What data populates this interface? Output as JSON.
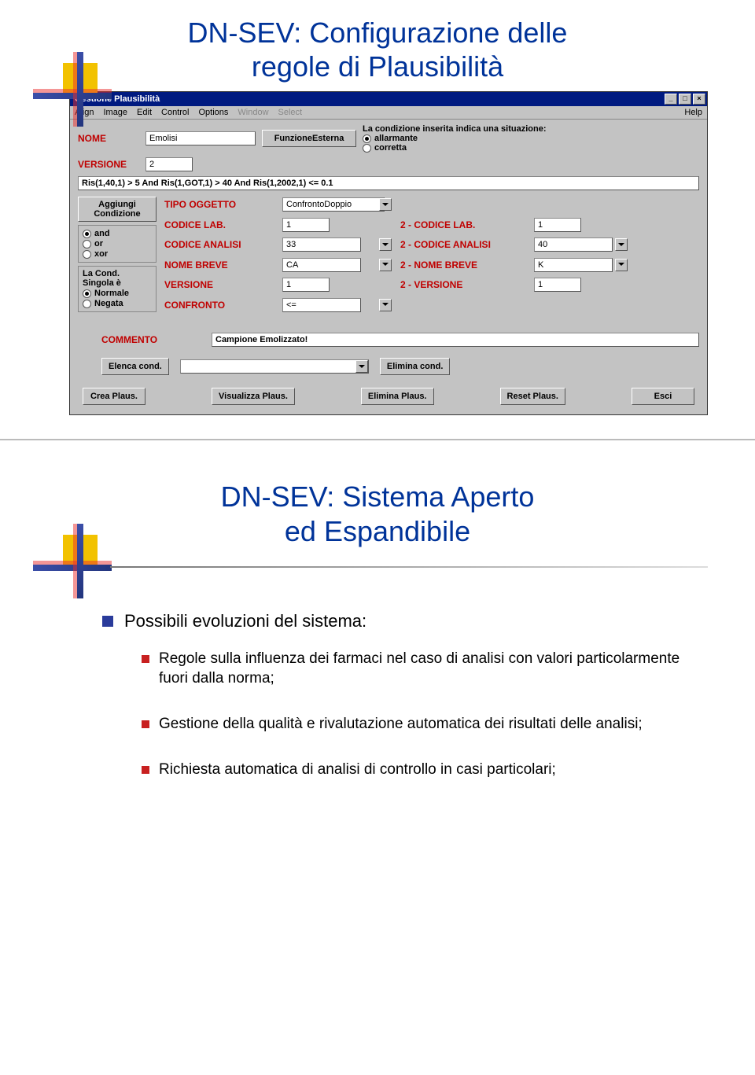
{
  "slide1": {
    "title_l1": "DN-SEV: Configurazione delle",
    "title_l2": "regole di Plausibilità"
  },
  "app": {
    "title": "Gestione Plausibilità",
    "menu": {
      "align": "Align",
      "image": "Image",
      "edit": "Edit",
      "control": "Control",
      "options": "Options",
      "window": "Window",
      "select": "Select",
      "help": "Help"
    },
    "header": {
      "nome_label": "NOME",
      "versione_label": "VERSIONE",
      "nome_value": "Emolisi",
      "versione_value": "2",
      "funz_btn": "FunzioneEsterna",
      "cond_text": "La condizione inserita indica una situazione:",
      "r_allarmante": "allarmante",
      "r_corretta": "corretta"
    },
    "cond_expr": "Ris(1,40,1) > 5 And Ris(1,GOT,1) > 40 And Ris(1,2002,1) <= 0.1",
    "left": {
      "aggiungi_l1": "Aggiungi",
      "aggiungi_l2": "Condizione",
      "and": "and",
      "or": "or",
      "xor": "xor",
      "lacond_l1": "La Cond.",
      "lacond_l2": "Singola è",
      "normale": "Normale",
      "negata": "Negata"
    },
    "fields": {
      "tipo_oggetto": "TIPO OGGETTO",
      "tipo_oggetto_v": "ConfrontoDoppio",
      "codice_lab": "CODICE LAB.",
      "codice_lab_v": "1",
      "codice_analisi": "CODICE ANALISI",
      "codice_analisi_v": "33",
      "nome_breve": "NOME BREVE",
      "nome_breve_v": "CA",
      "versione": "VERSIONE",
      "versione_v": "1",
      "confronto": "CONFRONTO",
      "confronto_v": "<="
    },
    "fields2": {
      "codice_lab": "2 - CODICE LAB.",
      "codice_lab_v": "1",
      "codice_analisi": "2 - CODICE ANALISI",
      "codice_analisi_v": "40",
      "nome_breve": "2 - NOME BREVE",
      "nome_breve_v": "K",
      "versione": "2 - VERSIONE",
      "versione_v": "1"
    },
    "commento_lbl": "COMMENTO",
    "commento_v": "Campione Emolizzato!",
    "btns": {
      "elenca": "Elenca cond.",
      "elimina_cond": "Elimina cond.",
      "crea": "Crea Plaus.",
      "visualizza": "Visualizza Plaus.",
      "elimina": "Elimina Plaus.",
      "reset": "Reset Plaus.",
      "esci": "Esci"
    }
  },
  "slide2": {
    "title_l1": "DN-SEV: Sistema Aperto",
    "title_l2": "ed Espandibile",
    "lead": "Possibili evoluzioni del sistema:",
    "items": [
      "Regole sulla influenza dei farmaci nel caso di analisi con valori particolarmente fuori dalla norma;",
      "Gestione della qualità e rivalutazione automatica dei risultati delle analisi;",
      "Richiesta automatica di analisi di controllo in casi particolari;"
    ]
  }
}
